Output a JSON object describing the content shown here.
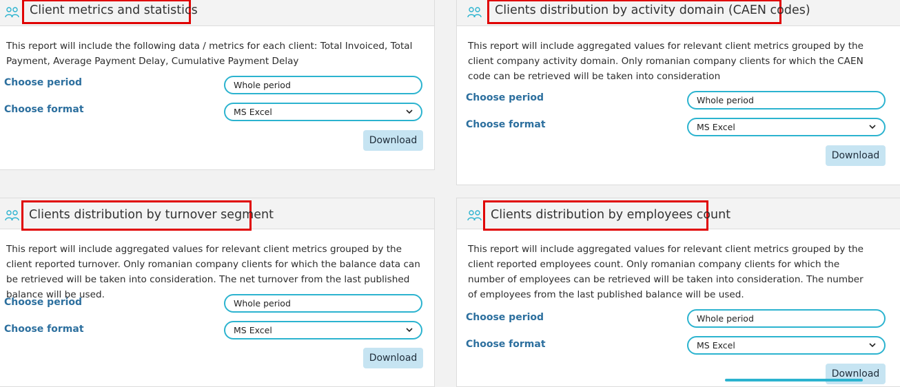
{
  "panels": [
    {
      "title": "Client metrics and statistics",
      "description": "This report will include the following data / metrics for each client: Total Invoiced, Total Payment, Average Payment Delay, Cumulative Payment Delay",
      "period_label": "Choose period",
      "period_value": "Whole period",
      "format_label": "Choose format",
      "format_value": "MS Excel",
      "download_label": "Download"
    },
    {
      "title": "Clients distribution by activity domain (CAEN codes)",
      "description": "This report will include aggregated values for relevant client metrics grouped by the client company activity domain. Only romanian company clients for which the CAEN code can be retrieved will be taken into consideration",
      "period_label": "Choose period",
      "period_value": "Whole period",
      "format_label": "Choose format",
      "format_value": "MS Excel",
      "download_label": "Download"
    },
    {
      "title": "Clients distribution by turnover segment",
      "description": "This report will include aggregated values for relevant client metrics grouped by the client reported turnover. Only romanian company clients for which the balance data can be retrieved will be taken into consideration. The net turnover from the last published balance will be used.",
      "period_label": "Choose period",
      "period_value": "Whole period",
      "format_label": "Choose format",
      "format_value": "MS Excel",
      "download_label": "Download"
    },
    {
      "title": "Clients distribution by employees count",
      "description": "This report will include aggregated values for relevant client metrics grouped by the client reported employees count. Only romanian company clients for which the number of employees can be retrieved will be taken into consideration. The number of employees from the last published balance will be used.",
      "period_label": "Choose period",
      "period_value": "Whole period",
      "format_label": "Choose format",
      "format_value": "MS Excel",
      "download_label": "Download"
    }
  ],
  "icons": {
    "header_icon": "users-group-icon",
    "select_icon": "chevron-down-icon"
  },
  "colors": {
    "highlight_border": "#e00000",
    "label_text": "#2c6f9e",
    "field_border": "#2bb3cf",
    "button_bg": "#c6e4f2"
  }
}
